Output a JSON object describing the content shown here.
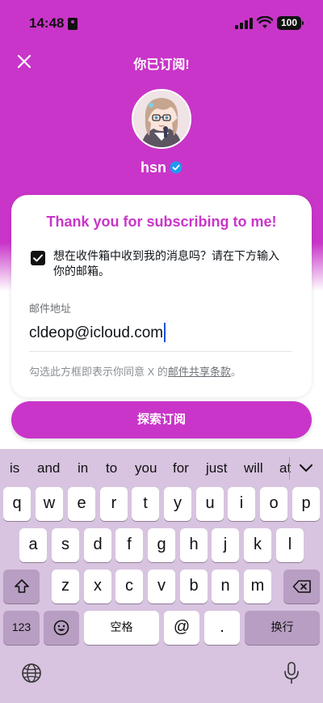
{
  "status_bar": {
    "time": "14:48",
    "battery": "100"
  },
  "header": {
    "title": "你已订阅!"
  },
  "profile": {
    "name": "hsn"
  },
  "card": {
    "title": "Thank you for subscribing to me!",
    "opt_in_line1": "想在收件箱中收到我的消息吗？请在下方输入",
    "opt_in_line2": "你的邮箱。",
    "email_label": "邮件地址",
    "email_value": "cldeop@icloud.com",
    "terms_prefix": "勾选此方框即表示你同意 X 的",
    "terms_link": "邮件共享条款",
    "terms_suffix": "。"
  },
  "explore_button": {
    "label": "探索订阅"
  },
  "keyboard": {
    "suggestions": [
      "is",
      "and",
      "in",
      "to",
      "you",
      "for",
      "just",
      "will",
      "at"
    ],
    "row1": [
      "q",
      "w",
      "e",
      "r",
      "t",
      "y",
      "u",
      "i",
      "o",
      "p"
    ],
    "row2": [
      "a",
      "s",
      "d",
      "f",
      "g",
      "h",
      "j",
      "k",
      "l"
    ],
    "row3": [
      "z",
      "x",
      "c",
      "v",
      "b",
      "n",
      "m"
    ],
    "numbers_key": "123",
    "space_key": "空格",
    "at_key": "@",
    "period_key": ".",
    "return_key": "换行"
  },
  "colors": {
    "accent": "#c935c9",
    "verified": "#1d9bf0",
    "keyboard_bg": "#d8c3e0"
  }
}
